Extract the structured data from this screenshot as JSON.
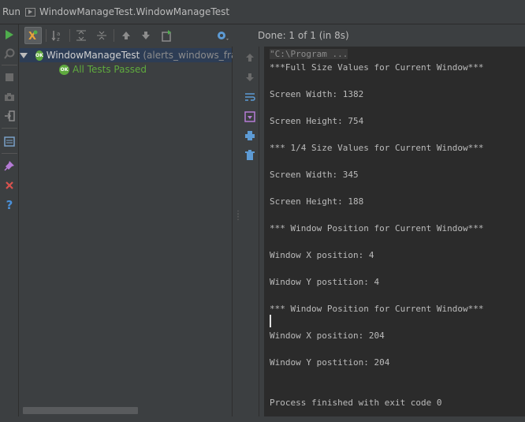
{
  "title_bar": {
    "run_label": "Run",
    "config_name": "WindowManageTest.WindowManageTest"
  },
  "toolbar": {
    "status": "Done: 1 of 1 (in 8s)"
  },
  "test_tree": {
    "root_label": "WindowManageTest",
    "root_detail": "(alerts_windows_fran",
    "badge_text": "OK",
    "child_label": "All Tests Passed",
    "colors": {
      "passed": "#5faa3e",
      "selection": "#2d3d55"
    }
  },
  "console": {
    "command_line": "\"C:\\Program ...",
    "lines": [
      "***Full Size Values for Current Window***",
      "",
      "Screen Width: 1382",
      "",
      "Screen Height: 754",
      "",
      "*** 1/4 Size Values for Current Window***",
      "",
      "Screen Width: 345",
      "",
      "Screen Height: 188",
      "",
      "*** Window Position for Current Window***",
      "",
      "Window X position: 4",
      "",
      "Window Y postition: 4",
      "",
      "*** Window Position for Current Window***",
      "",
      "Window X position: 204",
      "",
      "Window Y postition: 204",
      "",
      "",
      "Process finished with exit code 0"
    ]
  }
}
